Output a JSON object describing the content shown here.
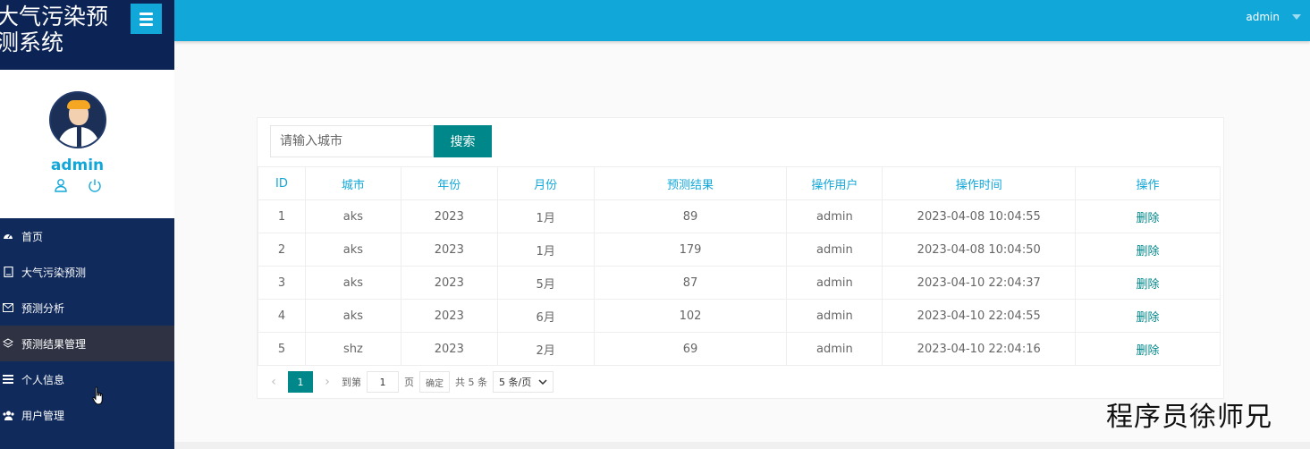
{
  "brand": {
    "title": "大气污染预测系统"
  },
  "topbar": {
    "user": "admin"
  },
  "profile": {
    "name": "admin",
    "icons": [
      "user-icon",
      "power-icon"
    ]
  },
  "nav": {
    "items": [
      {
        "label": "首页",
        "icon": "dashboard-icon"
      },
      {
        "label": "大气污染预测",
        "icon": "book-icon"
      },
      {
        "label": "预测分析",
        "icon": "mail-icon"
      },
      {
        "label": "预测结果管理",
        "icon": "layers-icon",
        "active": true
      },
      {
        "label": "个人信息",
        "icon": "list-icon"
      },
      {
        "label": "用户管理",
        "icon": "users-icon"
      }
    ]
  },
  "search": {
    "placeholder": "请输入城市",
    "button": "搜索"
  },
  "table": {
    "headers": [
      "ID",
      "城市",
      "年份",
      "月份",
      "预测结果",
      "操作用户",
      "操作时间",
      "操作"
    ],
    "rows": [
      [
        "1",
        "aks",
        "2023",
        "1月",
        "89",
        "admin",
        "2023-04-08 10:04:55",
        "删除"
      ],
      [
        "2",
        "aks",
        "2023",
        "1月",
        "179",
        "admin",
        "2023-04-08 10:04:50",
        "删除"
      ],
      [
        "3",
        "aks",
        "2023",
        "5月",
        "87",
        "admin",
        "2023-04-10 22:04:37",
        "删除"
      ],
      [
        "4",
        "aks",
        "2023",
        "6月",
        "102",
        "admin",
        "2023-04-10 22:04:55",
        "删除"
      ],
      [
        "5",
        "shz",
        "2023",
        "2月",
        "69",
        "admin",
        "2023-04-10 22:04:16",
        "删除"
      ]
    ]
  },
  "pager": {
    "current": "1",
    "goto_prefix": "到第",
    "goto_value": "1",
    "goto_suffix": "页",
    "confirm": "确定",
    "total": "共 5 条",
    "page_size": "5 条/页"
  },
  "watermark": "程序员徐师兄",
  "colors": {
    "primary": "#12a7d9",
    "accent": "#00878a",
    "sidebar": "#0f2a5b"
  }
}
